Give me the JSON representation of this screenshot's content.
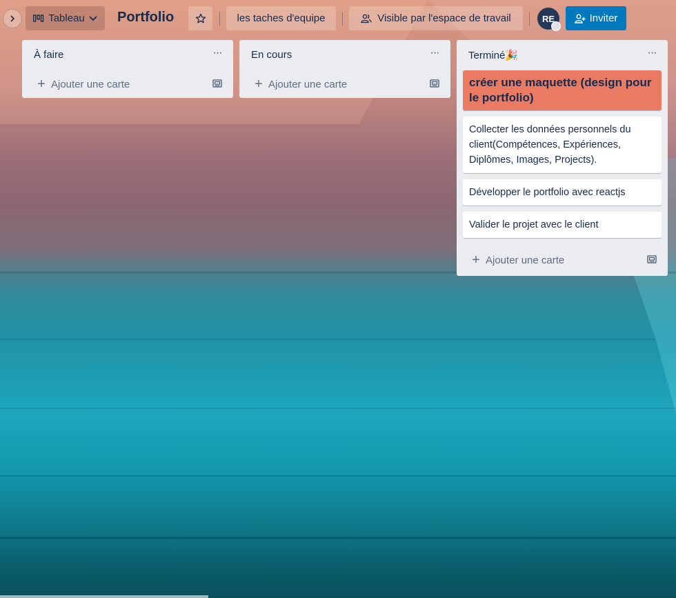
{
  "header": {
    "view_label": "Tableau",
    "board_title": "Portfolio",
    "workspace_label": "les taches d'equipe",
    "visibility_label": "Visible par l'espace de travail",
    "avatar_initials": "RE",
    "invite_label": "Inviter"
  },
  "lists": [
    {
      "title": "À faire",
      "add_card_label": "Ajouter une carte",
      "cards": []
    },
    {
      "title": "En cours",
      "add_card_label": "Ajouter une carte",
      "cards": []
    },
    {
      "title": "Terminé",
      "title_emoji": "🎉",
      "add_card_label": "Ajouter une carte",
      "cards": [
        {
          "text": "créer une maquette (design pour le portfolio)",
          "label_color": "#eb7a63"
        },
        {
          "text": "Collecter les données personnels du client(Compétences, Expériences, Diplômes, Images, Projects)."
        },
        {
          "text": "Développer le portfolio avec reactjs"
        },
        {
          "text": "Valider le projet avec le client"
        }
      ]
    }
  ],
  "colors": {
    "invite_button": "#0079bf",
    "list_background": "#ebecf0",
    "highlight_card": "#eb7a63",
    "text": "#172b4d"
  },
  "icons": {
    "sidebar_toggle": "chevron-right-icon",
    "view": "board-icon",
    "view_dropdown": "chevron-down-icon",
    "star": "star-icon",
    "visibility": "people-icon",
    "invite": "add-user-icon",
    "list_menu": "more-icon",
    "add_card": "plus-icon",
    "template": "card-template-icon"
  }
}
